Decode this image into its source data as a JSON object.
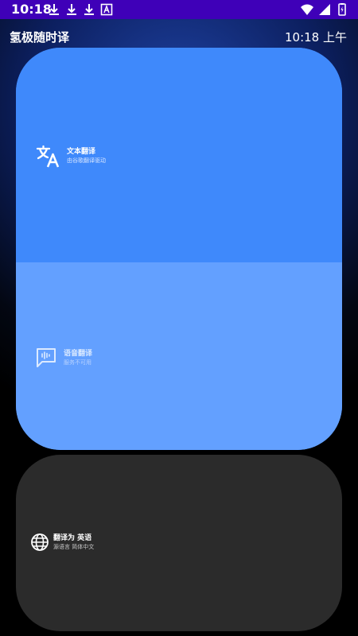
{
  "status_bar": {
    "time": "10:18",
    "icons": [
      "download-icon",
      "download-icon",
      "download-icon",
      "font-app-icon",
      "wifi-icon",
      "signal-icon",
      "battery-icon"
    ]
  },
  "header": {
    "app_title": "氢极随时译",
    "clock": "10:18 上午"
  },
  "text_translation": {
    "title": "文本翻译",
    "subtitle": "由谷歌翻译驱动",
    "icon": "translate-icon"
  },
  "voice_translation": {
    "title": "语音翻译",
    "subtitle": "服务不可用",
    "icon": "voice-chat-icon"
  },
  "target_language": {
    "label": "翻译为",
    "language": "英语",
    "source_label": "源语言",
    "source_language": "简体中文",
    "icon": "globe-icon"
  },
  "colors": {
    "status_bar": "#3f00b8",
    "text_panel": "#3f89fb",
    "voice_panel": "#63a0ff",
    "bottom_card": "#2b2b2b"
  }
}
